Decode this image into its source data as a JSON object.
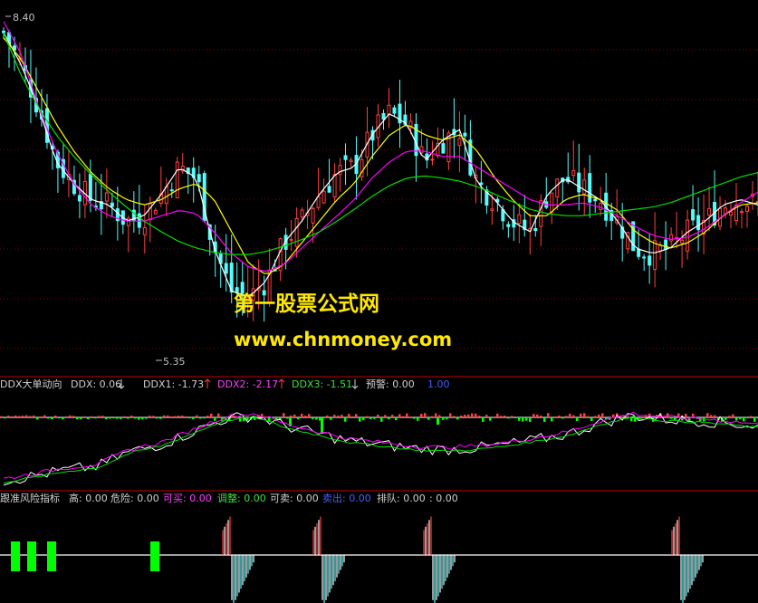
{
  "watermark": {
    "line1": "第一股票公式网",
    "line2": "www.chnmoney.com"
  },
  "price_panel": {
    "high_label": "8.40",
    "low_label": "5.35"
  },
  "ddx_panel": {
    "name": "DDX大单动向",
    "ddx": "DDX: 0.06",
    "ddx1": "DDX1: -1.73",
    "ddx2": "DDX2: -2.17",
    "ddx3": "DDX3: -1.51",
    "warn": "预警: 0.00",
    "extra": "1.00"
  },
  "risk_panel": {
    "name": "跟准风险指标",
    "high": "高: 0.00",
    "danger": "危险: 0.00",
    "buyable": "可买: 0.00",
    "adjust": "调整: 0.00",
    "sellable": "可卖: 0.00",
    "sellout": "卖出: 0.00",
    "queue": "排队: 0.00",
    "extra": ": 0.00"
  },
  "colors": {
    "up": "#FF4040",
    "down": "#54FCFC",
    "ma_white": "#FFFFFF",
    "ma_yellow": "#FFFF00",
    "ma_magenta": "#FF00FF",
    "ma_green": "#00E000",
    "grid": "#800000",
    "bar_green": "#00FF00"
  },
  "chart_data": [
    {
      "type": "candlestick",
      "ylim": [
        5.2,
        8.5
      ],
      "price_markers": [
        {
          "label": "8.40",
          "value": 8.4
        },
        {
          "label": "5.35",
          "value": 5.35
        }
      ],
      "series": [
        {
          "values": [
            8.3,
            8.0,
            7.6,
            7.1,
            6.9,
            6.75,
            6.7,
            6.55,
            6.6,
            6.8,
            7.05,
            6.95,
            6.3,
            5.9,
            5.85,
            6.0,
            6.35,
            6.55,
            6.8,
            7.0,
            7.05,
            7.35,
            7.55,
            7.45,
            7.1,
            7.3,
            7.4,
            6.9,
            6.75,
            6.55,
            6.45,
            6.8,
            6.95,
            6.85,
            6.75,
            6.55,
            6.3,
            6.25,
            6.3,
            6.45,
            6.55,
            6.7,
            6.75,
            6.7
          ]
        },
        {
          "values": [
            8.25,
            8.05,
            7.75,
            7.45,
            7.2,
            7.0,
            6.85,
            6.75,
            6.7,
            6.75,
            6.85,
            6.9,
            6.75,
            6.45,
            6.15,
            6.05,
            6.15,
            6.35,
            6.55,
            6.75,
            6.9,
            7.15,
            7.35,
            7.45,
            7.35,
            7.3,
            7.35,
            7.2,
            6.95,
            6.75,
            6.6,
            6.6,
            6.75,
            6.8,
            6.75,
            6.65,
            6.45,
            6.35,
            6.3,
            6.35,
            6.45,
            6.6,
            6.7,
            6.72
          ]
        },
        {
          "values": [
            8.4,
            8.1,
            7.6,
            7.2,
            6.9,
            6.7,
            6.6,
            6.55,
            6.55,
            6.6,
            6.65,
            6.62,
            6.45,
            6.25,
            6.12,
            6.08,
            6.15,
            6.3,
            6.45,
            6.6,
            6.75,
            6.95,
            7.1,
            7.2,
            7.2,
            7.15,
            7.15,
            7.05,
            6.95,
            6.85,
            6.75,
            6.7,
            6.7,
            6.72,
            6.68,
            6.6,
            6.5,
            6.42,
            6.38,
            6.4,
            6.48,
            6.6,
            6.72,
            6.82
          ]
        },
        {
          "values": [
            8.3,
            7.9,
            7.6,
            7.35,
            7.15,
            6.98,
            6.82,
            6.68,
            6.55,
            6.45,
            6.36,
            6.3,
            6.26,
            6.24,
            6.24,
            6.27,
            6.32,
            6.38,
            6.45,
            6.55,
            6.66,
            6.78,
            6.88,
            6.95,
            6.97,
            6.95,
            6.92,
            6.87,
            6.8,
            6.73,
            6.66,
            6.62,
            6.6,
            6.6,
            6.62,
            6.64,
            6.66,
            6.68,
            6.72,
            6.78,
            6.84,
            6.9,
            6.96,
            7.0
          ]
        }
      ]
    }
  ]
}
